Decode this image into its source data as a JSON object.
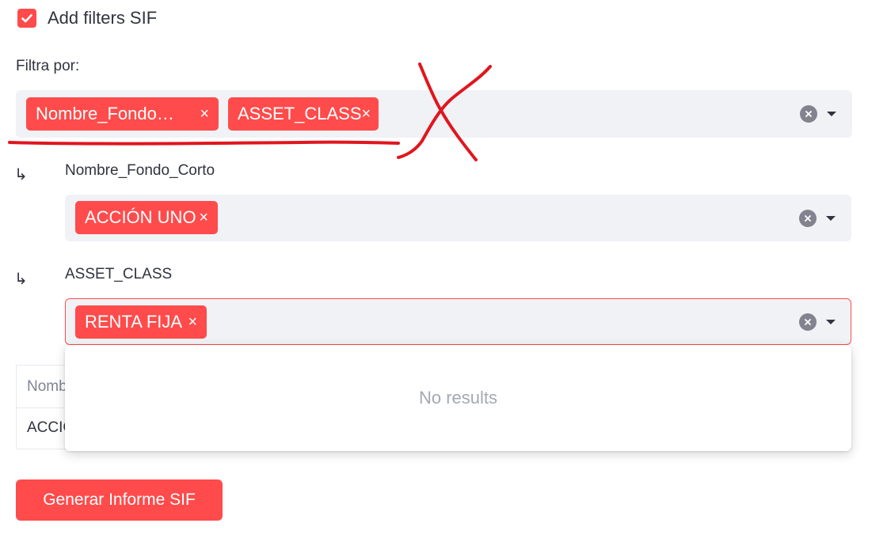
{
  "checkbox": {
    "label": "Add filters SIF",
    "checked": true
  },
  "filter_by": {
    "label": "Filtra por:",
    "tags": [
      "Nombre_Fondo…",
      "ASSET_CLASS"
    ]
  },
  "filters": [
    {
      "label": "Nombre_Fondo_Corto",
      "tags": [
        "ACCIÓN UNO"
      ]
    },
    {
      "label": "ASSET_CLASS",
      "tags": [
        "RENTA FIJA"
      ]
    }
  ],
  "sub_arrow_glyph": "↳",
  "tag_close_glyph": "×",
  "dropdown": {
    "empty_text": "No results"
  },
  "table": {
    "header_partial": "Nomb",
    "cell_partial": "ACCIC"
  },
  "button": {
    "label": "Generar Informe SIF"
  },
  "colors": {
    "accent": "#ff4b4b",
    "input_background": "#f0f2f6",
    "text": "#31333f",
    "annotation": "#e0161e"
  }
}
